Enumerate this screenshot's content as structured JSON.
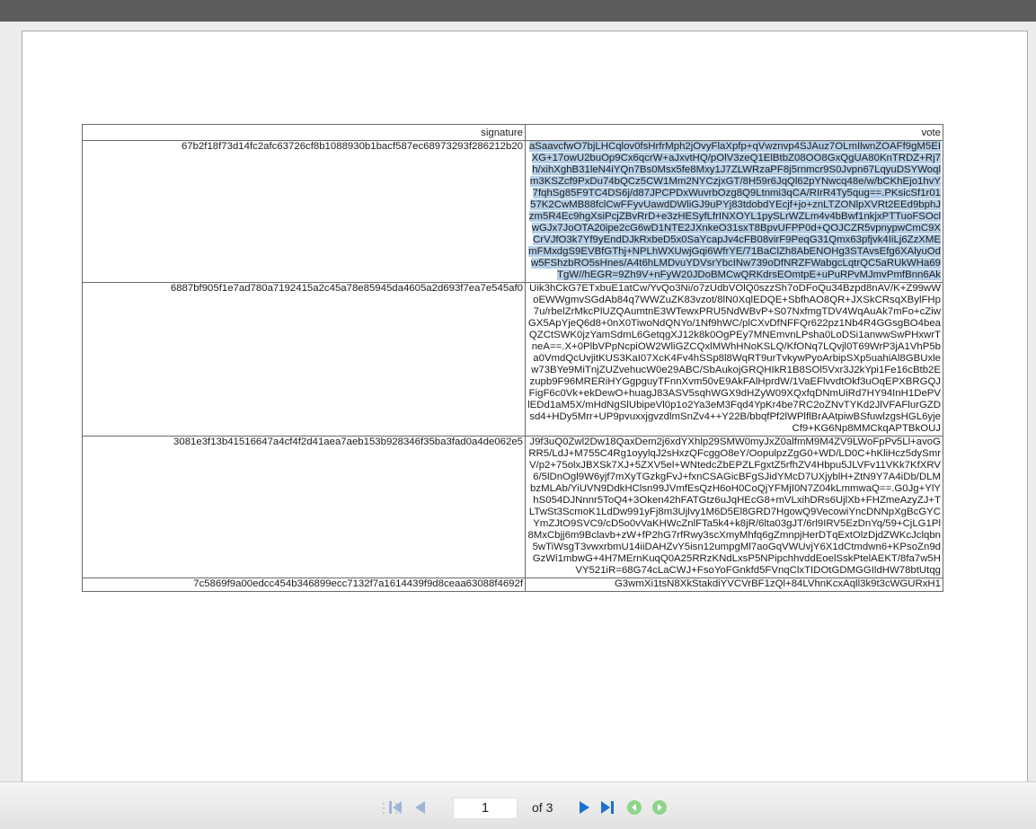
{
  "table": {
    "headers": [
      "signature",
      "vote"
    ],
    "rows": [
      {
        "signature": "67b2f18f73d14fc2afc63726cf8b1088930b1bacf587ec68973293f286212b20",
        "vote": "aSaavcfwO7bjLHCqlov0fsHrfrMph2jOvyFlaXpfp+qVwznvp4SJAuz7OLmIlwnZOAFf9gM5EIXG+17owU2buOp9Cx6qcrW+aJxvtHQ/pOlV3zeQ1ElBtbZ08OO8GxQgUA80KnTRDZ+Rj7h/xihXghB31leN4iYQn7Bs0Msx5fe8Mxy1J7ZLWRzaPF8j5rnmcr9S0Jvpn67LqyuDSYWoqlm3KSZcf9PxDu74bQCz5CW1Mm2NYCzjxGT/8H59r6JqQl62pYNwcq48e/w/bCKhEjo1hvY7fqhSg85F9TC4DS6j/d87JPCPDxWuvrbOzg8Q9Ltnmi3qCA/RIrR4Ty5qug==.PKsicSf1r0157K2CwMB88fclCwFFyvUawdDWliGJ9uPYj83tdobdYEcjf+jo+znLTZONlpXVRt2EEd9bphJzm5R4Ec9hgXsiPcjZBvRrD+e3zHESyfLfrINXOYL1pySLrWZLm4v4bBwf1nkjxPTTuoFSOclwGJx7JoOTA20ipe2cG6wD1NTE2JXnkeO31sxT8BpvUFPP0d+QOJCZR5vpnypwCmC9XCrVJfO3k7Yf9yEndDJkRxbeD5x0SaYcapJv4cFB08virF9PeqG31Qmx63pfjvk4IiLj6ZzXMEmFMxdgS9EVBfGThj+NPLhWXUwjGqi6WfrYE/71BaClZh8AbENOHg3STAvsEfg6XAlyuOdw5FShzbRO5sHnes/A4t6hLMDvuYDVsrYbcINw739oDfNRZFWabgcLqtrQC5aRUkWHa69TgW//hEGR=9Zh9V+nFyW20JDoBMCwQRKdrsEOmtpE+uPuRPvMJmvPmfBnn6Ak",
        "selected": true
      },
      {
        "signature": "6887bf905f1e7ad780a7192415a2c45a78e85945da4605a2d693f7ea7e545af0",
        "vote": "Uik3hCkG7ETxbuE1atCw/YvQo3Ni/o7zUdbVOlQ0szzSh7oDFoQu34Bzpd8nAV/K+Z99wWoEWWgmvSGdAb84q7WWZuZK83vzot/8lN0XqlEDQE+SbfhAO8QR+JXSkCRsqXBylFHp7u/rbelZrMkcPlUZQAumtnE3WTewxPRU5NdWBvP+S07NxfmgTDV4WqAuAk7mFo+cZiwGX5ApYjeQ6d8+0nX0TiwoNdQNYo/1Nf9hWC/plCXvDfNFFQr622pz1Nb4R4GGsgBO4beaQZCtSWK0jzYamSdmL6GetqgXJ12k8k0OgPEy7MNEmvnLPsha0LoDSi1anwwSwPHxwrTneA==.X+0PlbVPpNcpiOW2WliGZCQxlMWhHNoKSLQ/KfONq7LQvjl0T69WrP3jA1VhP5ba0VmdQcUvjitKUS3KaI07XcK4Fv4hSSp8l8WqRT9urTvkywPyoArbipSXp5uahiAl8GBUxlew73BYe9MiTnjZUZvehucW0e29ABC/SbAukojGRQHIkR1B8SOl5Vxr3J2kYpi1Fe16cBtb2Ezupb9F96MRERiHYGgpguyTFnnXvm50vE9AkFAlHprdW/1VaEFlvvdtOkf3uOqEPXBRGQJFigF6c0Vk+ekDewO+huagJ83ASV5sqhWGX9dHZyW09XQxfqDNmUiRd7HY94InH1DePVlEDd1aM5X/mHdNgSlUbipeVl0p1o2Ya3eM3Fqd4YpKr4be7RC2oZNvTYKd2JlVFAFlurGZDsd4+HDy5Mrr+UP9pvuxxjgvzdlmSnZv4++Y22B/bbqfPf2lWPlflBrAAtpiwBSfuwlzgsHGL6yjeCf9+KG6Np8MMCkqAPTBkOUJ",
        "selected": false
      },
      {
        "signature": "3081e3f13b41516647a4cf4f2d41aea7aeb153b928346f35ba3fad0a4de062e5",
        "vote": "J9f3uQ0Zwl2Dw18QaxDem2j6xdYXhlp29SMW0myJxZ0alfmM9M4ZV9LWoFpPv5Ll+avoGRR5/LdJ+M755C4Rg1oyylqJ2sHxzQFcggO8eY/OopulpzZgG0+WD/LD0C+hKliHcz5dySmrV/p2+75olxJBXSk7XJ+5ZXV5el+WNtedcZbEPZLFgxtZ5rfhZV4Hbpu5JLVFv11VKk7KfXRV6/5lDnOgl9W6yjf7mXyTGzkgFvJ+fxnCSAGicBFgSJidYMcD7UXjyblH+ZtN9Y7A4iDb/DLMbzMLAb/YiUVN9DdkHClsn99JVmfEsQzH6oH0CoQjYFMjI0N7Z04kLmmwaQ==.G0Jg+YlYhS054DJNnnr5ToQ4+3Oken42hFATGtz6uJqHEcG8+mVLxihDRs6UjlXb+FHZmeAzyZJ+TLTwSt3ScmoK1LdDw991yFj8m3Ujlvy1M6D5El8GRD7HgowQ9VecowiYncDNNpXgBcGYCYmZJtO9SVC9/cD5o0vVaKHWcZnlFTa5k4+k8jR/6lta03gJT/6rl9IRV5EzDnYq/59+CjLG1Pl8MxCbjj6m9Bclavb+zW+fP2hG7rfRwy3scXmyMhfq6gZmnpjHerDTqExtOlzDjdZWKcJclqbn5wTiWsgT3vwxrbmU14iiDAHZvY5isn12umpgMl7aoGqVWUvjY6X1dCtmdwn6+KPsoZn9dGzWi1mbwG+4H7MErnKuqQ0A25RRzKNdLxsP5NPipchhvddEoelSskPtelAEKT/8fa7w5HVY521iR=68G74cLaCWJ+FsoYoFGnkfd5FVnqClxTIDOtGDMGGIldHW78btUtqg",
        "selected": false
      },
      {
        "signature": "7c5869f9a00edcc454b346899ecc7132f7a1614439f9d8ceaa63088f4692f",
        "vote": "G3wmXi1tsN8XkStakdiYVCVrBF1zQl+84LVhnKcxAqll3k9t3cWGURxH1",
        "selected": false
      }
    ]
  },
  "toolbar": {
    "page_input": "1",
    "of_label": "of 3",
    "colors": {
      "nav_disabled": "#9eb6d6",
      "nav_enabled": "#1d6fd0",
      "history": "#8fd48a"
    },
    "icons": [
      "grip-icon",
      "first-page-icon",
      "previous-page-icon",
      "next-page-icon",
      "last-page-icon",
      "back-icon",
      "forward-icon"
    ]
  }
}
